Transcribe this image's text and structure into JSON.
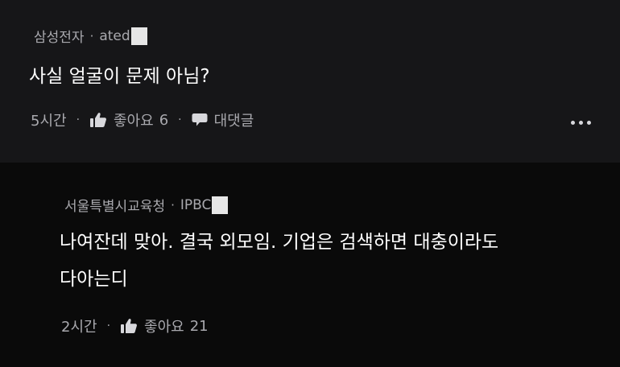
{
  "comment": {
    "author_org": "삼성전자",
    "author_name": "ated",
    "separator": "·",
    "text": "사실 얼굴이 문제 아님?",
    "time": "5시간",
    "like_label": "좋아요",
    "like_count": "6",
    "reply_label": "대댓글",
    "more_icon": "more-horizontal-icon"
  },
  "reply": {
    "author_org": "서울특별시교육청",
    "author_name": "IPBC",
    "separator": "·",
    "text_line1": "나여잔데 맞아. 결국 외모임. 기업은 검색하면 대충이라도",
    "text_line2": "다아는디",
    "time": "2시간",
    "like_label": "좋아요",
    "like_count": "21"
  },
  "colors": {
    "comment_bg": "#161618",
    "reply_bg": "#0a0a0a",
    "meta_text": "#a9a9ae",
    "body_text": "#ffffff"
  }
}
